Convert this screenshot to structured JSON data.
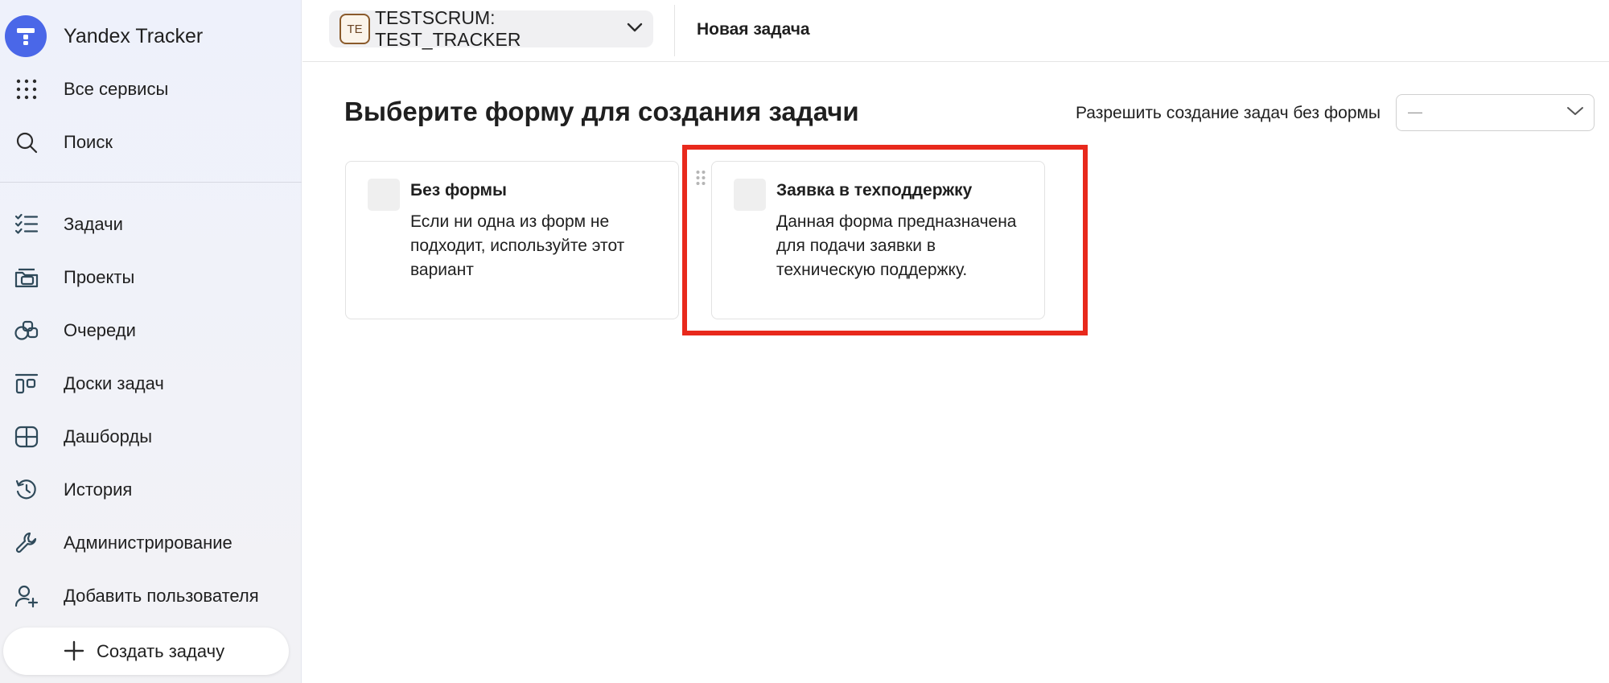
{
  "sidebar": {
    "brand": "Yandex Tracker",
    "items": [
      {
        "label": "Все сервисы",
        "icon": "grid-dots-icon"
      },
      {
        "label": "Поиск",
        "icon": "search-icon"
      },
      {
        "label": "Задачи",
        "icon": "task-list-icon"
      },
      {
        "label": "Проекты",
        "icon": "projects-icon"
      },
      {
        "label": "Очереди",
        "icon": "queues-icon"
      },
      {
        "label": "Доски задач",
        "icon": "boards-icon"
      },
      {
        "label": "Дашборды",
        "icon": "dashboards-icon"
      },
      {
        "label": "История",
        "icon": "history-icon"
      },
      {
        "label": "Администрирование",
        "icon": "wrench-icon"
      },
      {
        "label": "Добавить пользователя",
        "icon": "add-user-icon"
      }
    ],
    "create_button": "Создать задачу"
  },
  "header": {
    "queue_avatar": "TE",
    "queue_name": "TESTSCRUM: TEST_TRACKER",
    "title": "Новая задача"
  },
  "main": {
    "title": "Выберите форму для создания задачи",
    "allow_label": "Разрешить создание задач без формы",
    "allow_value": "—",
    "cards": [
      {
        "title": "Без формы",
        "description": "Если ни одна из форм не подходит, используйте этот вариант"
      },
      {
        "title": "Заявка в техподдержку",
        "description": "Данная форма предназначена для подачи заявки в техническую поддержку."
      }
    ]
  },
  "colors": {
    "brand": "#4a67e8",
    "highlight": "#e8291c",
    "sidebar_bg": "#eef1fb"
  }
}
